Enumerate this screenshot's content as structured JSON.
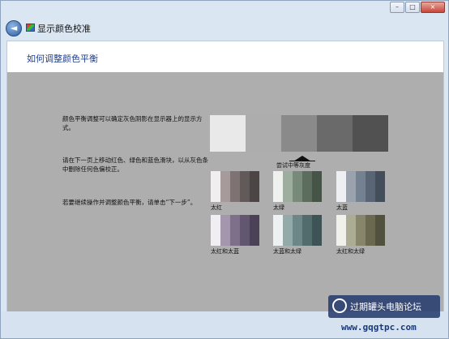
{
  "window": {
    "title": "显示颜色校准",
    "controls": [
      "minimize-icon",
      "maximize-icon",
      "close-icon"
    ]
  },
  "page": {
    "heading": "如何调整颜色平衡"
  },
  "instructions": [
    "颜色平衡调整可以确定灰色阴影在显示器上的显示方式。",
    "请在下一页上移动红色、绿色和蓝色滑块，以从灰色条中删除任何色偏校正。",
    "若要继续操作并调整颜色平衡，请单击“下一步”。"
  ],
  "target": {
    "label": "尝试中等灰度",
    "colors": [
      "#e9e9e9",
      "#adadad",
      "#8a8a8a",
      "#6a6a6a",
      "#515151"
    ]
  },
  "samples": [
    {
      "label": "太红",
      "colors": [
        "#f0eeee",
        "#a69a9b",
        "#7e7273",
        "#625959",
        "#4c4545"
      ]
    },
    {
      "label": "太绿",
      "colors": [
        "#eef1ee",
        "#9eae9e",
        "#788a79",
        "#5c6d5d",
        "#465447"
      ]
    },
    {
      "label": "太蓝",
      "colors": [
        "#eeeff2",
        "#9aa3ad",
        "#748190",
        "#596574",
        "#444e5a"
      ]
    },
    {
      "label": "太红和太蓝",
      "colors": [
        "#f0eef2",
        "#a497ad",
        "#7e6f8a",
        "#625671",
        "#4b4258"
      ]
    },
    {
      "label": "太蓝和太绿",
      "colors": [
        "#eef1f1",
        "#93aaaa",
        "#6d8789",
        "#526b6d",
        "#3e5355"
      ]
    },
    {
      "label": "太红和太绿",
      "colors": [
        "#f1f1ec",
        "#acab93",
        "#87866b",
        "#6a6950",
        "#52513d"
      ]
    }
  ],
  "watermark": {
    "text": "过期罐头电脑论坛",
    "url": "www.gqgtpc.com",
    "icon": "logo-icon"
  }
}
